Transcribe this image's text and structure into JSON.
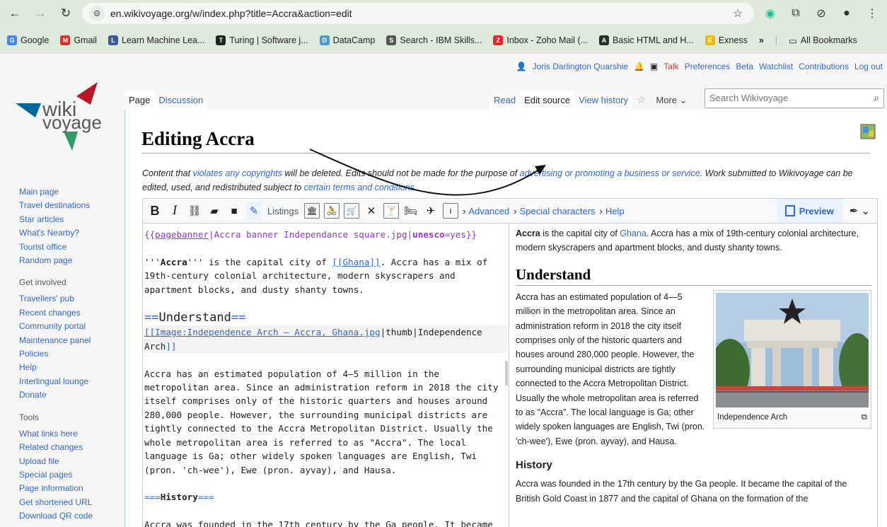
{
  "browser": {
    "url": "en.wikivoyage.org/w/index.php?title=Accra&action=edit",
    "bookmarks": [
      {
        "label": "Google",
        "color": "#4285f4",
        "glyph": "G"
      },
      {
        "label": "Gmail",
        "color": "#d93025",
        "glyph": "M"
      },
      {
        "label": "Learn Machine Lea...",
        "color": "#3b5998",
        "glyph": "L"
      },
      {
        "label": "Turing | Software j...",
        "color": "#222222",
        "glyph": "T"
      },
      {
        "label": "DataCamp",
        "color": "#4a9bd4",
        "glyph": "D"
      },
      {
        "label": "Search - IBM Skills...",
        "color": "#555555",
        "glyph": "S"
      },
      {
        "label": "Inbox - Zoho Mail (...",
        "color": "#e42527",
        "glyph": "Z"
      },
      {
        "label": "Basic HTML and H...",
        "color": "#2b2b2b",
        "glyph": "A"
      },
      {
        "label": "Exness",
        "color": "#f0b90b",
        "glyph": "E"
      }
    ],
    "overflow": "»",
    "all_bookmarks": "All Bookmarks"
  },
  "personal": {
    "user": "Joris Darlington Quarshie",
    "links": [
      "Talk",
      "Preferences",
      "Beta",
      "Watchlist",
      "Contributions",
      "Log out"
    ]
  },
  "logo": {
    "line1": "wiki",
    "line2": "voyage"
  },
  "sidebar": {
    "nav": [
      "Main page",
      "Travel destinations",
      "Star articles",
      "What's Nearby?",
      "Tourist office",
      "Random page"
    ],
    "involved_title": "Get involved",
    "involved": [
      "Travellers' pub",
      "Recent changes",
      "Community portal",
      "Maintenance panel",
      "Policies",
      "Help",
      "Interlingual lounge",
      "Donate"
    ],
    "tools_title": "Tools",
    "tools": [
      "What links here",
      "Related changes",
      "Upload file",
      "Special pages",
      "Page information",
      "Get shortened URL",
      "Download QR code"
    ]
  },
  "tabs": {
    "page": "Page",
    "discussion": "Discussion",
    "read": "Read",
    "edit_source": "Edit source",
    "view_history": "View history",
    "more": "More",
    "search_placeholder": "Search Wikivoyage"
  },
  "heading": "Editing Accra",
  "notice": {
    "t1": "Content that ",
    "l1": "violates any copyrights",
    "t2": " will be deleted. Edits should not be made for the purpose of ",
    "l2": "advertising or promoting a business or service",
    "t3": ". Work submitted to Wikivoyage can be edited, used, and redistributed subject to ",
    "l3": "certain terms and conditions",
    "t4": "."
  },
  "toolbar": {
    "listings": "Listings",
    "advanced": "Advanced",
    "special": "Special characters",
    "help": "Help",
    "preview": "Preview"
  },
  "editor": {
    "pb_open": "{{",
    "pb_name": "pagebanner",
    "pb_mid": "|Accra banner Independance square.jpg|",
    "pb_key": "unesco",
    "pb_end": "=yes}}",
    "p1_a": "'''",
    "p1_b": "Accra",
    "p1_c": "''' is the capital city of ",
    "p1_link": "[[Ghana]]",
    "p1_d": ". Accra has a mix of 19th-century colonial architecture, modern skyscrapers and apartment blocks, and dusty shanty towns.",
    "h_eq1": "==",
    "h_text": "Understand",
    "h_eq2": "==",
    "img_link": "[[Image:Independence Arch – Accra, Ghana.jpg",
    "img_rest": "|thumb|Independence Arch",
    "img_end": "]]",
    "p2": "Accra has an estimated population of 4–5 million in the metropolitan area. Since an administration reform in 2018 the city itself comprises only of the historic quarters and houses around 280,000 people. However, the surrounding municipal districts are tightly connected to the Accra Metropolitan District. Usually the whole metropolitan area is referred to as \"Accra\". The local language is Ga; other widely spoken languages are English, Twi (pron. 'ch-wee'), Ewe (pron. ayvay), and Hausa.",
    "h3_eq1": "===",
    "h3_text": "History",
    "h3_eq2": "===",
    "p3": "Accra was founded in the 17th century by the Ga people. It became"
  },
  "preview": {
    "intro_b": "Accra",
    "intro_1": " is the capital city of ",
    "intro_link": "Ghana",
    "intro_2": ". Accra has a mix of 19th-century colonial architecture, modern skyscrapers and apartment blocks, and dusty shanty towns.",
    "h2": "Understand",
    "caption": "Independence Arch",
    "p2": "Accra has an estimated population of 4—5 million in the metropolitan area. Since an administration reform in 2018 the city itself comprises only of the historic quarters and houses around 280,000 people. However, the surrounding municipal districts are tightly connected to the Accra Metropolitan District. Usually the whole metropolitan area is referred to as \"Accra\". The local language is Ga; other widely spoken languages are English, Twi (pron. 'ch-wee'), Ewe (pron. ayvay), and Hausa.",
    "h3": "History",
    "p3": "Accra was founded in the 17th century by the Ga people. It became the capital of the British Gold Coast in 1877 and the capital of Ghana on the formation of the"
  },
  "colors": {
    "link": "#3366cc",
    "browser_chrome": "#dfeadc",
    "logo_red": "#b61723",
    "logo_blue": "#006699",
    "logo_green": "#339966"
  }
}
